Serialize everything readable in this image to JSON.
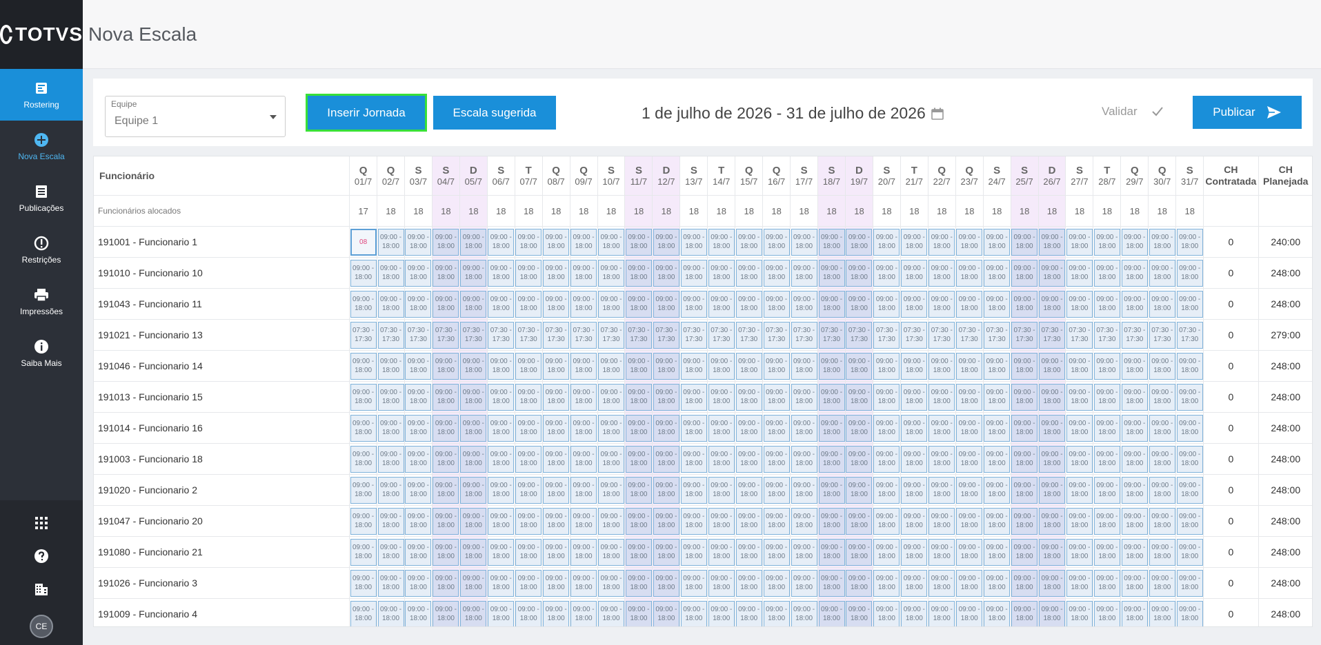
{
  "sidebar": {
    "logo": "TOTVS",
    "items": [
      {
        "label": "Rostering",
        "icon": "schedule-icon"
      },
      {
        "label": "Nova Escala",
        "icon": "plus-circle-icon"
      },
      {
        "label": "Publicações",
        "icon": "document-icon"
      },
      {
        "label": "Restrições",
        "icon": "alert-icon"
      },
      {
        "label": "Impressões",
        "icon": "printer-icon"
      },
      {
        "label": "Saiba Mais",
        "icon": "info-icon"
      }
    ],
    "avatar": "CE"
  },
  "header": {
    "title": "Nova Escala"
  },
  "toolbar": {
    "team_label": "Equipe",
    "team_value": "Equipe 1",
    "insert_label": "Inserir Jornada",
    "suggested_label": "Escala sugerida",
    "date_range": "1 de julho de 2026 - 31 de julho de 2026",
    "validate_label": "Validar",
    "publish_label": "Publicar"
  },
  "grid": {
    "employee_header": "Funcionário",
    "allocated_label": "Funcionários alocados",
    "ch_contratada": [
      "CH",
      "Contratada"
    ],
    "ch_planejada": [
      "CH",
      "Planejada"
    ],
    "days": [
      {
        "l": "Q",
        "d": "01/7",
        "c": "17"
      },
      {
        "l": "Q",
        "d": "02/7",
        "c": "18"
      },
      {
        "l": "S",
        "d": "03/7",
        "c": "18"
      },
      {
        "l": "S",
        "d": "04/7",
        "c": "18",
        "we": true
      },
      {
        "l": "D",
        "d": "05/7",
        "c": "18",
        "we": true
      },
      {
        "l": "S",
        "d": "06/7",
        "c": "18"
      },
      {
        "l": "T",
        "d": "07/7",
        "c": "18"
      },
      {
        "l": "Q",
        "d": "08/7",
        "c": "18"
      },
      {
        "l": "Q",
        "d": "09/7",
        "c": "18"
      },
      {
        "l": "S",
        "d": "10/7",
        "c": "18"
      },
      {
        "l": "S",
        "d": "11/7",
        "c": "18",
        "we": true
      },
      {
        "l": "D",
        "d": "12/7",
        "c": "18",
        "we": true
      },
      {
        "l": "S",
        "d": "13/7",
        "c": "18"
      },
      {
        "l": "T",
        "d": "14/7",
        "c": "18"
      },
      {
        "l": "Q",
        "d": "15/7",
        "c": "18"
      },
      {
        "l": "Q",
        "d": "16/7",
        "c": "18"
      },
      {
        "l": "S",
        "d": "17/7",
        "c": "18"
      },
      {
        "l": "S",
        "d": "18/7",
        "c": "18",
        "we": true
      },
      {
        "l": "D",
        "d": "19/7",
        "c": "18",
        "we": true
      },
      {
        "l": "S",
        "d": "20/7",
        "c": "18"
      },
      {
        "l": "T",
        "d": "21/7",
        "c": "18"
      },
      {
        "l": "Q",
        "d": "22/7",
        "c": "18"
      },
      {
        "l": "Q",
        "d": "23/7",
        "c": "18"
      },
      {
        "l": "S",
        "d": "24/7",
        "c": "18"
      },
      {
        "l": "S",
        "d": "25/7",
        "c": "18",
        "we": true
      },
      {
        "l": "D",
        "d": "26/7",
        "c": "18",
        "we": true
      },
      {
        "l": "S",
        "d": "27/7",
        "c": "18"
      },
      {
        "l": "T",
        "d": "28/7",
        "c": "18"
      },
      {
        "l": "Q",
        "d": "29/7",
        "c": "18"
      },
      {
        "l": "Q",
        "d": "30/7",
        "c": "18"
      },
      {
        "l": "S",
        "d": "31/7",
        "c": "18"
      }
    ],
    "rows": [
      {
        "name": "191001 - Funcionario 1",
        "shift": [
          "09:00 -",
          "18:00"
        ],
        "first": "08",
        "contratada": "0",
        "planejada": "240:00"
      },
      {
        "name": "191010 - Funcionario 10",
        "shift": [
          "09:00 -",
          "18:00"
        ],
        "contratada": "0",
        "planejada": "248:00"
      },
      {
        "name": "191043 - Funcionario 11",
        "shift": [
          "09:00 -",
          "18:00"
        ],
        "contratada": "0",
        "planejada": "248:00"
      },
      {
        "name": "191021 - Funcionario 13",
        "shift": [
          "07:30 -",
          "17:30"
        ],
        "contratada": "0",
        "planejada": "279:00"
      },
      {
        "name": "191046 - Funcionario 14",
        "shift": [
          "09:00 -",
          "18:00"
        ],
        "contratada": "0",
        "planejada": "248:00"
      },
      {
        "name": "191013 - Funcionario 15",
        "shift": [
          "09:00 -",
          "18:00"
        ],
        "contratada": "0",
        "planejada": "248:00"
      },
      {
        "name": "191014 - Funcionario 16",
        "shift": [
          "09:00 -",
          "18:00"
        ],
        "contratada": "0",
        "planejada": "248:00"
      },
      {
        "name": "191003 - Funcionario 18",
        "shift": [
          "09:00 -",
          "18:00"
        ],
        "contratada": "0",
        "planejada": "248:00"
      },
      {
        "name": "191020 - Funcionario 2",
        "shift": [
          "09:00 -",
          "18:00"
        ],
        "contratada": "0",
        "planejada": "248:00"
      },
      {
        "name": "191047 - Funcionario 20",
        "shift": [
          "09:00 -",
          "18:00"
        ],
        "contratada": "0",
        "planejada": "248:00"
      },
      {
        "name": "191080 - Funcionario 21",
        "shift": [
          "09:00 -",
          "18:00"
        ],
        "contratada": "0",
        "planejada": "248:00"
      },
      {
        "name": "191026 - Funcionario 3",
        "shift": [
          "09:00 -",
          "18:00"
        ],
        "contratada": "0",
        "planejada": "248:00"
      },
      {
        "name": "191009 - Funcionario 4",
        "shift": [
          "09:00 -",
          "18:00"
        ],
        "contratada": "0",
        "planejada": "248:00"
      }
    ]
  }
}
